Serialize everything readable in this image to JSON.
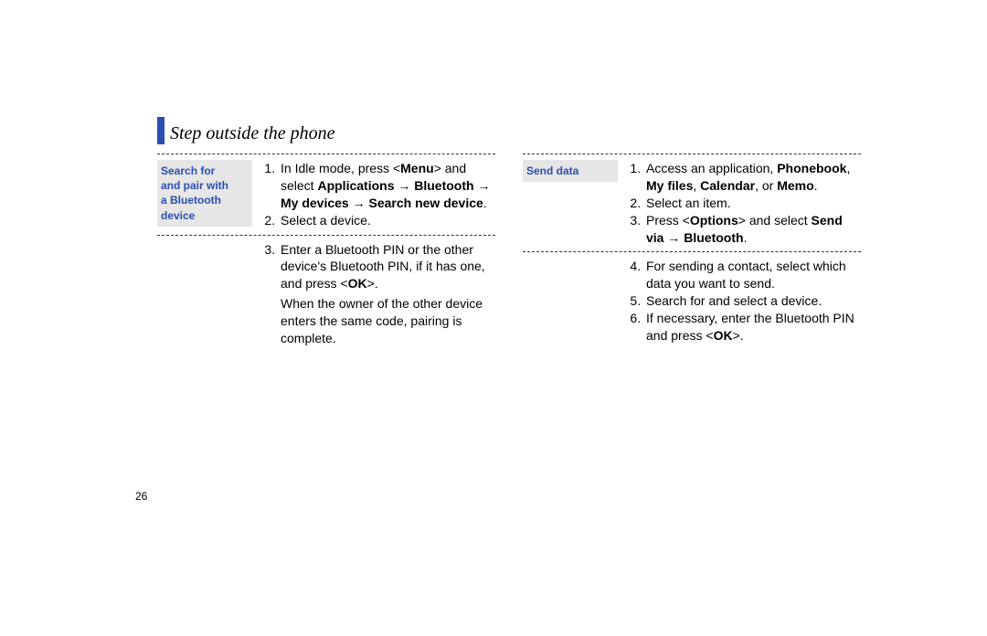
{
  "header": {
    "title": "Step outside the phone"
  },
  "left": {
    "tag_l1": "Search for",
    "tag_l2": "and pair with",
    "tag_l3": "a Bluetooth",
    "tag_l4": "device",
    "s1_pre": "In Idle mode, press <",
    "s1_menu": "Menu",
    "s1_mid": "> and select ",
    "s1_path": "Applications → Bluetooth → My devices → Search new device",
    "s1_end": ".",
    "s2": "Select a device.",
    "s3_pre": "Enter a Bluetooth PIN or the other device's Bluetooth PIN, if it has one, and press <",
    "s3_ok": "OK",
    "s3_end": ">.",
    "s3_extra": "When the owner of the other device enters the same code, pairing is complete."
  },
  "right": {
    "tag": "Send data",
    "r1_pre": "Access an application, ",
    "r1_pb": "Phonebook",
    "r1_c1": ", ",
    "r1_mf": "My files",
    "r1_c2": ", ",
    "r1_cal": "Calendar",
    "r1_or": ", or ",
    "r1_memo": "Memo",
    "r1_end": ".",
    "r2": "Select an item.",
    "r3_pre": "Press <",
    "r3_opt": "Options",
    "r3_mid": "> and select ",
    "r3_send": "Send via → Bluetooth",
    "r3_end": ".",
    "r4": "For sending a contact, select which data you want to send.",
    "r5": "Search for and select a device.",
    "r6_pre": "If necessary, enter the Bluetooth PIN and press <",
    "r6_ok": "OK",
    "r6_end": ">."
  },
  "page_number": "26"
}
